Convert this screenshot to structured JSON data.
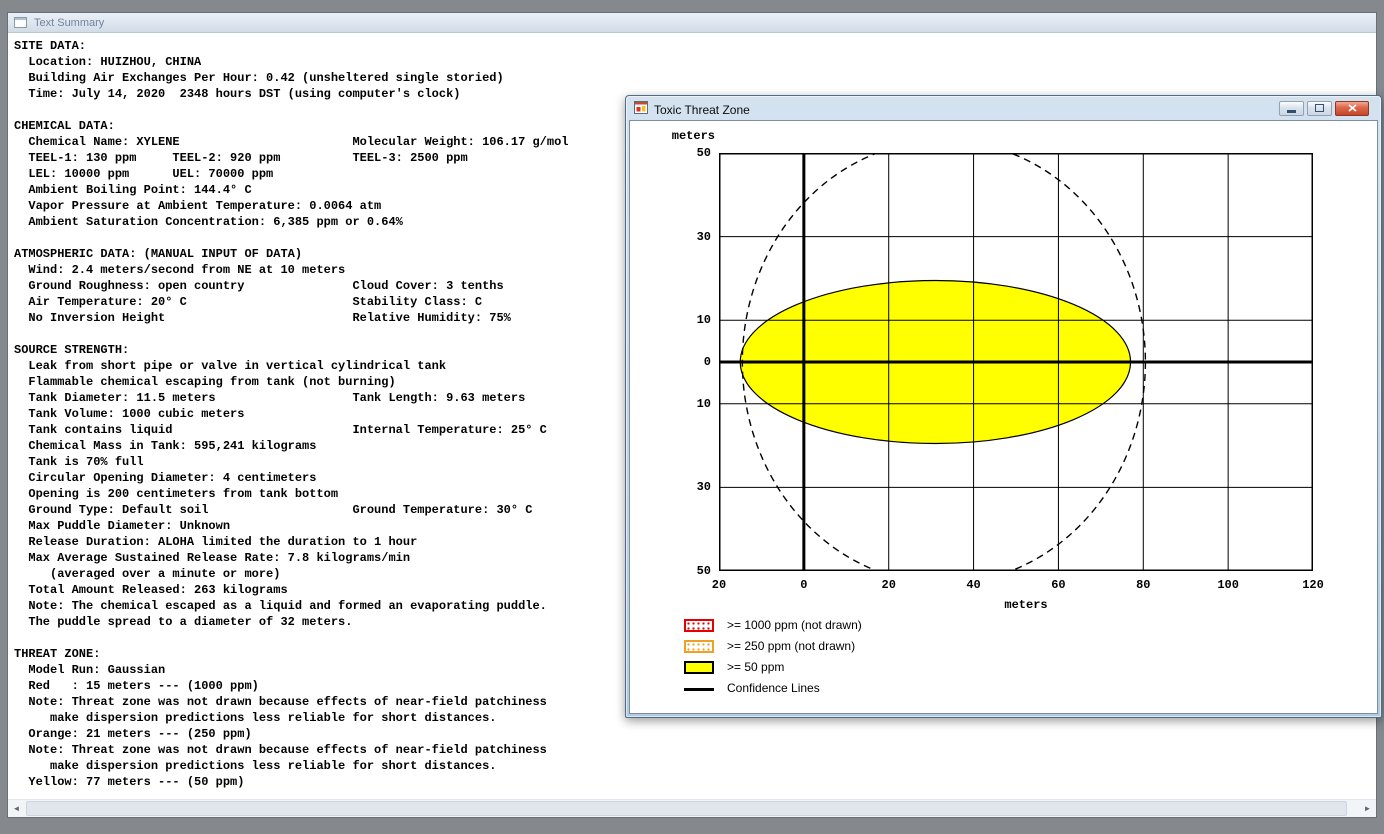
{
  "text_summary_window": {
    "title": "Text Summary",
    "lines": [
      "SITE DATA:",
      "  Location: HUIZHOU, CHINA",
      "  Building Air Exchanges Per Hour: 0.42 (unsheltered single storied)",
      "  Time: July 14, 2020  2348 hours DST (using computer's clock)",
      "",
      "CHEMICAL DATA:",
      "  Chemical Name: XYLENE                        Molecular Weight: 106.17 g/mol",
      "  TEEL-1: 130 ppm     TEEL-2: 920 ppm          TEEL-3: 2500 ppm",
      "  LEL: 10000 ppm      UEL: 70000 ppm",
      "  Ambient Boiling Point: 144.4° C",
      "  Vapor Pressure at Ambient Temperature: 0.0064 atm",
      "  Ambient Saturation Concentration: 6,385 ppm or 0.64%",
      "",
      "ATMOSPHERIC DATA: (MANUAL INPUT OF DATA)",
      "  Wind: 2.4 meters/second from NE at 10 meters",
      "  Ground Roughness: open country               Cloud Cover: 3 tenths",
      "  Air Temperature: 20° C                       Stability Class: C",
      "  No Inversion Height                          Relative Humidity: 75%",
      "",
      "SOURCE STRENGTH:",
      "  Leak from short pipe or valve in vertical cylindrical tank",
      "  Flammable chemical escaping from tank (not burning)",
      "  Tank Diameter: 11.5 meters                   Tank Length: 9.63 meters",
      "  Tank Volume: 1000 cubic meters",
      "  Tank contains liquid                         Internal Temperature: 25° C",
      "  Chemical Mass in Tank: 595,241 kilograms",
      "  Tank is 70% full",
      "  Circular Opening Diameter: 4 centimeters",
      "  Opening is 200 centimeters from tank bottom",
      "  Ground Type: Default soil                    Ground Temperature: 30° C",
      "  Max Puddle Diameter: Unknown",
      "  Release Duration: ALOHA limited the duration to 1 hour",
      "  Max Average Sustained Release Rate: 7.8 kilograms/min",
      "     (averaged over a minute or more)",
      "  Total Amount Released: 263 kilograms",
      "  Note: The chemical escaped as a liquid and formed an evaporating puddle.",
      "  The puddle spread to a diameter of 32 meters.",
      "",
      "THREAT ZONE:",
      "  Model Run: Gaussian",
      "  Red   : 15 meters --- (1000 ppm)",
      "  Note: Threat zone was not drawn because effects of near-field patchiness",
      "     make dispersion predictions less reliable for short distances.",
      "  Orange: 21 meters --- (250 ppm)",
      "  Note: Threat zone was not drawn because effects of near-field patchiness",
      "     make dispersion predictions less reliable for short distances.",
      "  Yellow: 77 meters --- (50 ppm)"
    ],
    "scrollbar": {
      "left_arrow": "◄",
      "right_arrow": "►"
    }
  },
  "threat_window": {
    "title": "Toxic Threat Zone",
    "legend": [
      {
        "style": "red",
        "color": "#e60000",
        "label": ">= 1000 ppm (not drawn)"
      },
      {
        "style": "orange",
        "color": "#eda125",
        "label": ">= 250 ppm (not drawn)"
      },
      {
        "style": "yellow",
        "color": "#ffff00",
        "label": ">= 50 ppm"
      },
      {
        "style": "line",
        "color": "#000000",
        "label": "Confidence Lines"
      }
    ]
  },
  "chart_data": {
    "type": "area",
    "title": "Toxic Threat Zone",
    "xlabel": "meters",
    "ylabel": "meters",
    "xlim": [
      -20,
      120
    ],
    "ylim": [
      -50,
      50
    ],
    "x_ticks": [
      -20,
      0,
      20,
      40,
      60,
      80,
      100,
      120
    ],
    "x_tick_labels": [
      "20",
      "0",
      "20",
      "40",
      "60",
      "80",
      "100",
      "120"
    ],
    "y_ticks": [
      50,
      30,
      10,
      0,
      -10,
      -30,
      -50
    ],
    "y_tick_labels": [
      "50",
      "30",
      "10",
      "0",
      "10",
      "30",
      "50"
    ],
    "grid": true,
    "axis_color": "#000000",
    "zones": [
      {
        "name": "yellow_zone_50ppm",
        "threshold_ppm": 50,
        "drawn": true,
        "color": "#ffff00",
        "shape": "ellipse",
        "center_m": [
          31,
          0
        ],
        "rx_m": 46,
        "ry_m": 19.5,
        "downwind_extent_m": 77
      },
      {
        "name": "orange_zone_250ppm",
        "threshold_ppm": 250,
        "drawn": false,
        "downwind_extent_m": 21
      },
      {
        "name": "red_zone_1000ppm",
        "threshold_ppm": 1000,
        "drawn": false,
        "downwind_extent_m": 15
      }
    ],
    "confidence_lines": {
      "shape": "ellipse",
      "center_m": [
        33,
        0
      ],
      "rx_m": 47.5,
      "ry_m": 53,
      "dash": [
        7,
        5
      ]
    }
  }
}
